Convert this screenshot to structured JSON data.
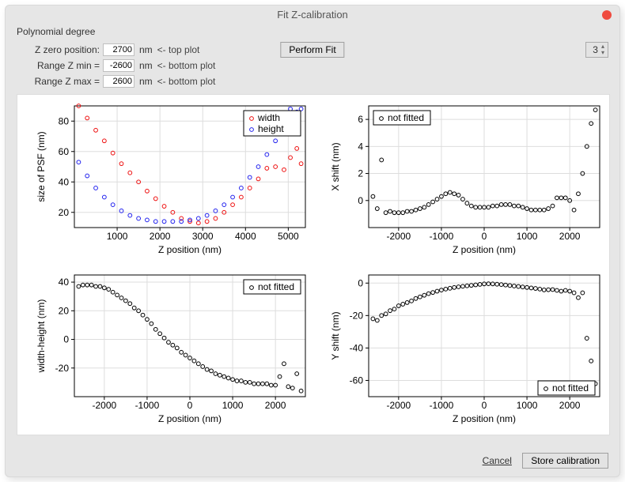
{
  "window_title": "Fit Z-calibration",
  "poly_label": "Polynomial degree",
  "degree_value": "3",
  "fields": {
    "z_zero": {
      "label": "Z zero position:",
      "value": "2700",
      "unit": "nm",
      "hint": "<- top plot"
    },
    "z_min": {
      "label": "Range Z min =",
      "value": "-2600",
      "unit": "nm",
      "hint": "<- bottom plot"
    },
    "z_max": {
      "label": "Range Z max =",
      "value": "2600",
      "unit": "nm",
      "hint": "<- bottom plot"
    }
  },
  "buttons": {
    "perform": "Perform Fit",
    "cancel": "Cancel",
    "store": "Store calibration"
  },
  "legends": {
    "width": "width",
    "height": "height",
    "not_fitted": "not fitted"
  },
  "chart_data": [
    {
      "id": "psf",
      "type": "scatter",
      "xlabel": "Z position (nm)",
      "ylabel": "size of PSF (nm)",
      "xlim": [
        0,
        5400
      ],
      "ylim": [
        10,
        90
      ],
      "xticks": [
        1000,
        2000,
        3000,
        4000,
        5000
      ],
      "yticks": [
        20,
        40,
        60,
        80
      ],
      "legend": [
        "width",
        "height"
      ],
      "series": [
        {
          "name": "width",
          "color": "red",
          "x": [
            100,
            300,
            500,
            700,
            900,
            1100,
            1300,
            1500,
            1700,
            1900,
            2100,
            2300,
            2500,
            2700,
            2900,
            3100,
            3300,
            3500,
            3700,
            3900,
            4100,
            4300,
            4500,
            4700,
            4900,
            5050,
            5200,
            5300
          ],
          "y": [
            90,
            82,
            74,
            67,
            59,
            52,
            46,
            40,
            34,
            29,
            24,
            20,
            16,
            14,
            13,
            14,
            16,
            20,
            25,
            30,
            36,
            42,
            49,
            50,
            48,
            56,
            62,
            52
          ]
        },
        {
          "name": "height",
          "color": "blue",
          "x": [
            100,
            300,
            500,
            700,
            900,
            1100,
            1300,
            1500,
            1700,
            1900,
            2100,
            2300,
            2500,
            2700,
            2900,
            3100,
            3300,
            3500,
            3700,
            3900,
            4100,
            4300,
            4500,
            4700,
            4900,
            5050,
            5200,
            5300
          ],
          "y": [
            53,
            44,
            36,
            30,
            25,
            21,
            18,
            16,
            15,
            14,
            14,
            14,
            14,
            15,
            16,
            18,
            21,
            25,
            30,
            36,
            43,
            50,
            58,
            67,
            77,
            88,
            86,
            88
          ]
        }
      ]
    },
    {
      "id": "xshift",
      "type": "scatter",
      "xlabel": "Z position (nm)",
      "ylabel": "X shift (nm)",
      "xlim": [
        -2700,
        2700
      ],
      "ylim": [
        -2,
        7
      ],
      "xticks": [
        -2000,
        -1000,
        0,
        1000,
        2000
      ],
      "yticks": [
        0,
        2,
        4,
        6
      ],
      "legend": [
        "not fitted"
      ],
      "legend_pos": "top-left",
      "series": [
        {
          "name": "x shift",
          "color": "black",
          "x": [
            -2600,
            -2500,
            -2400,
            -2300,
            -2200,
            -2100,
            -2000,
            -1900,
            -1800,
            -1700,
            -1600,
            -1500,
            -1400,
            -1300,
            -1200,
            -1100,
            -1000,
            -900,
            -800,
            -700,
            -600,
            -500,
            -400,
            -300,
            -200,
            -100,
            0,
            100,
            200,
            300,
            400,
            500,
            600,
            700,
            800,
            900,
            1000,
            1100,
            1200,
            1300,
            1400,
            1500,
            1600,
            1700,
            1800,
            1900,
            2000,
            2100,
            2200,
            2300,
            2400,
            2500,
            2600
          ],
          "y": [
            0.3,
            -0.6,
            3.0,
            -0.9,
            -0.8,
            -0.9,
            -0.9,
            -0.9,
            -0.8,
            -0.8,
            -0.7,
            -0.6,
            -0.5,
            -0.3,
            -0.1,
            0.1,
            0.3,
            0.5,
            0.6,
            0.5,
            0.4,
            0.1,
            -0.2,
            -0.4,
            -0.5,
            -0.5,
            -0.5,
            -0.5,
            -0.4,
            -0.4,
            -0.3,
            -0.3,
            -0.3,
            -0.4,
            -0.4,
            -0.5,
            -0.6,
            -0.7,
            -0.7,
            -0.7,
            -0.7,
            -0.6,
            -0.4,
            0.2,
            0.2,
            0.2,
            0.0,
            -0.7,
            0.5,
            2.0,
            4.0,
            5.7,
            6.7
          ]
        }
      ]
    },
    {
      "id": "wh",
      "type": "scatter",
      "xlabel": "Z position (nm)",
      "ylabel": "width-height (nm)",
      "xlim": [
        -2700,
        2700
      ],
      "ylim": [
        -40,
        45
      ],
      "xticks": [
        -2000,
        -1000,
        0,
        1000,
        2000
      ],
      "yticks": [
        -20,
        0,
        20,
        40
      ],
      "legend": [
        "not fitted"
      ],
      "legend_pos": "top-right",
      "series": [
        {
          "name": "w-h",
          "color": "black",
          "x": [
            -2600,
            -2500,
            -2400,
            -2300,
            -2200,
            -2100,
            -2000,
            -1900,
            -1800,
            -1700,
            -1600,
            -1500,
            -1400,
            -1300,
            -1200,
            -1100,
            -1000,
            -900,
            -800,
            -700,
            -600,
            -500,
            -400,
            -300,
            -200,
            -100,
            0,
            100,
            200,
            300,
            400,
            500,
            600,
            700,
            800,
            900,
            1000,
            1100,
            1200,
            1300,
            1400,
            1500,
            1600,
            1700,
            1800,
            1900,
            2000,
            2100,
            2200,
            2300,
            2400,
            2500,
            2600
          ],
          "y": [
            37,
            38,
            38,
            38,
            37,
            37,
            36,
            35,
            33,
            31,
            29,
            27,
            25,
            22,
            20,
            17,
            14,
            11,
            7,
            4,
            1,
            -2,
            -4,
            -6,
            -9,
            -11,
            -13,
            -15,
            -17,
            -19,
            -21,
            -22,
            -24,
            -25,
            -26,
            -27,
            -28,
            -29,
            -29,
            -30,
            -30,
            -31,
            -31,
            -31,
            -31,
            -32,
            -32,
            -26,
            -17,
            -33,
            -34,
            -24,
            -36
          ]
        }
      ]
    },
    {
      "id": "yshift",
      "type": "scatter",
      "xlabel": "Z position (nm)",
      "ylabel": "Y shift (nm)",
      "xlim": [
        -2700,
        2700
      ],
      "ylim": [
        -70,
        5
      ],
      "xticks": [
        -2000,
        -1000,
        0,
        1000,
        2000
      ],
      "yticks": [
        -60,
        -40,
        -20,
        0
      ],
      "legend": [
        "not fitted"
      ],
      "legend_pos": "bottom-right",
      "series": [
        {
          "name": "y shift",
          "color": "black",
          "x": [
            -2600,
            -2500,
            -2400,
            -2300,
            -2200,
            -2100,
            -2000,
            -1900,
            -1800,
            -1700,
            -1600,
            -1500,
            -1400,
            -1300,
            -1200,
            -1100,
            -1000,
            -900,
            -800,
            -700,
            -600,
            -500,
            -400,
            -300,
            -200,
            -100,
            0,
            100,
            200,
            300,
            400,
            500,
            600,
            700,
            800,
            900,
            1000,
            1100,
            1200,
            1300,
            1400,
            1500,
            1600,
            1700,
            1800,
            1900,
            2000,
            2100,
            2200,
            2300,
            2400,
            2500,
            2600
          ],
          "y": [
            -22,
            -23,
            -20,
            -19,
            -17,
            -16,
            -14,
            -13,
            -12,
            -11,
            -9.5,
            -8.5,
            -7.5,
            -6.5,
            -5.8,
            -5,
            -4.3,
            -3.7,
            -3.2,
            -2.7,
            -2.3,
            -2,
            -1.7,
            -1.4,
            -1.1,
            -0.8,
            -0.5,
            -0.4,
            -0.5,
            -0.7,
            -0.9,
            -1.2,
            -1.5,
            -1.8,
            -2.1,
            -2.4,
            -2.7,
            -3,
            -3.3,
            -3.7,
            -4.2,
            -4.1,
            -4,
            -4.5,
            -5,
            -4.5,
            -5,
            -6,
            -9,
            -6,
            -34,
            -48,
            -62
          ]
        }
      ]
    }
  ]
}
